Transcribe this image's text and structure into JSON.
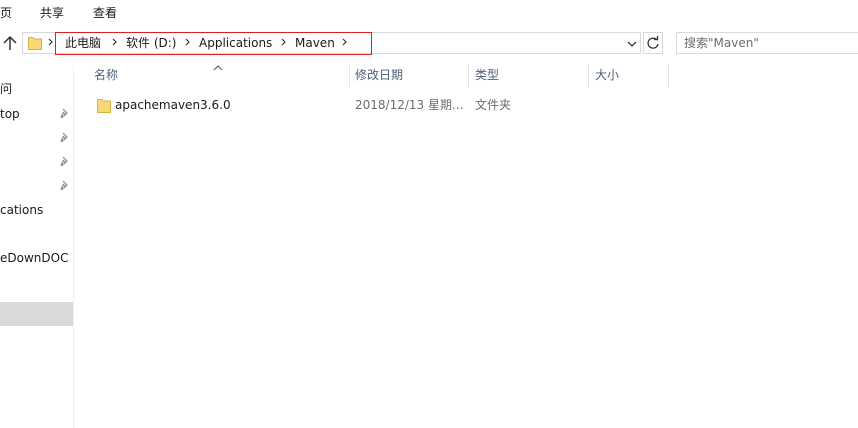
{
  "ribbon": {
    "tabs": [
      "页",
      "共享",
      "查看"
    ]
  },
  "address_bar": {
    "crumbs": [
      "此电脑",
      "软件 (D:)",
      "Applications",
      "Maven"
    ]
  },
  "search": {
    "placeholder": "搜索\"Maven\""
  },
  "nav_pane": {
    "items": [
      "问",
      "top",
      "",
      "",
      "",
      "cations",
      "eDownDOC"
    ]
  },
  "columns": {
    "name": "名称",
    "date_modified": "修改日期",
    "type": "类型",
    "size": "大小"
  },
  "files": [
    {
      "name": "apachemaven3.6.0",
      "date_modified": "2018/12/13 星期...",
      "type": "文件夹",
      "size": ""
    }
  ],
  "colors": {
    "highlight_border": "#e02020",
    "folder_yellow": "#f8d775",
    "header_text": "#4c607a",
    "selected_bg": "#d9d9d9"
  }
}
